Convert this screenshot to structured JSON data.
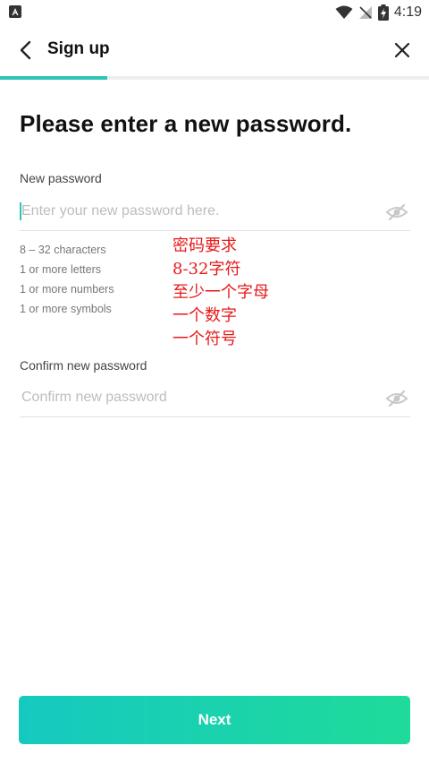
{
  "status_bar": {
    "time": "4:19"
  },
  "header": {
    "title": "Sign up"
  },
  "progress": {
    "fraction": 0.25
  },
  "main": {
    "title": "Please enter a new password.",
    "new_password": {
      "label": "New password",
      "placeholder": "Enter your new password here."
    },
    "requirements": [
      "8 – 32 characters",
      "1 or more letters",
      "1 or more numbers",
      "1 or more symbols"
    ],
    "annotation": [
      "密码要求",
      "8-32字符",
      "至少一个字母",
      "一个数字",
      "一个符号"
    ],
    "confirm_password": {
      "label": "Confirm new password",
      "placeholder": "Confirm new password"
    }
  },
  "footer": {
    "next_label": "Next"
  },
  "colors": {
    "accent": "#2ec4b6",
    "button_start": "#16c9c0",
    "button_end": "#1fdb9a",
    "annotation": "#e81818"
  }
}
